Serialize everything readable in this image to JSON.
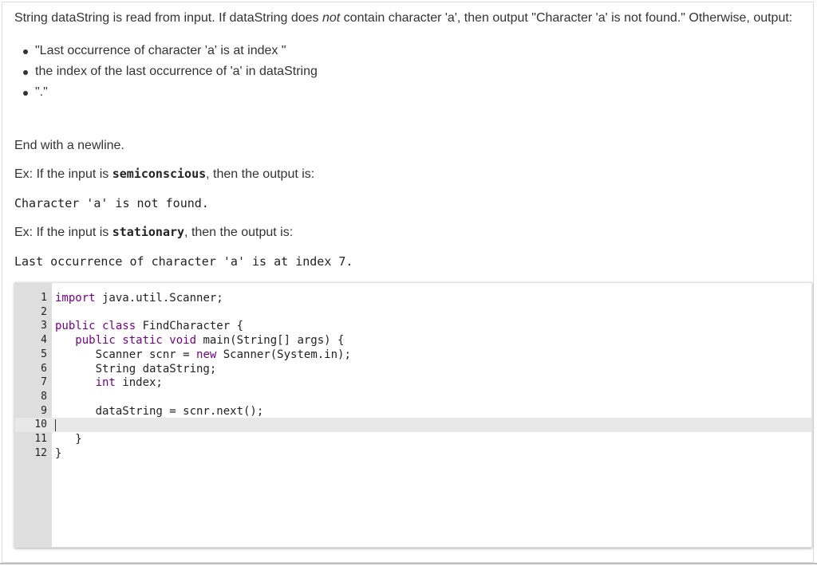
{
  "problem": {
    "intro_prefix": "String dataString is read from input. If dataString does ",
    "intro_em": "not",
    "intro_suffix": " contain character 'a', then output \"Character 'a' is not found.\" Otherwise, output:",
    "bullets": [
      "\"Last occurrence of character 'a' is at index \"",
      "the index of the last occurrence of 'a' in dataString",
      "\".\""
    ],
    "end_note": "End with a newline.",
    "example1": {
      "prefix": "Ex: If the input is ",
      "input": "semiconscious",
      "suffix": ", then the output is:",
      "output": "Character 'a' is not found."
    },
    "example2": {
      "prefix": "Ex: If the input is ",
      "input": "stationary",
      "suffix": ", then the output is:",
      "output": "Last occurrence of character 'a' is at index 7."
    }
  },
  "editor": {
    "active_line": 10,
    "lines": [
      {
        "n": "1",
        "kw": "import",
        "rest": " java.util.Scanner;"
      },
      {
        "n": "2",
        "kw": "",
        "rest": ""
      },
      {
        "n": "3",
        "kw": "public class",
        "rest": " FindCharacter {"
      },
      {
        "n": "4",
        "kw": "   public static void",
        "rest": " main(String[] args) {"
      },
      {
        "n": "5",
        "kw": "",
        "rest": "      Scanner scnr = ",
        "kw2": "new",
        "rest2": " Scanner(System.in);"
      },
      {
        "n": "6",
        "kw": "",
        "rest": "      String dataString;"
      },
      {
        "n": "7",
        "kw": "      int",
        "rest": " index;"
      },
      {
        "n": "8",
        "kw": "",
        "rest": ""
      },
      {
        "n": "9",
        "kw": "",
        "rest": "      dataString = scnr.next();"
      },
      {
        "n": "10",
        "kw": "",
        "rest": ""
      },
      {
        "n": "11",
        "kw": "",
        "rest": "   }"
      },
      {
        "n": "12",
        "kw": "",
        "rest": "}"
      }
    ]
  }
}
